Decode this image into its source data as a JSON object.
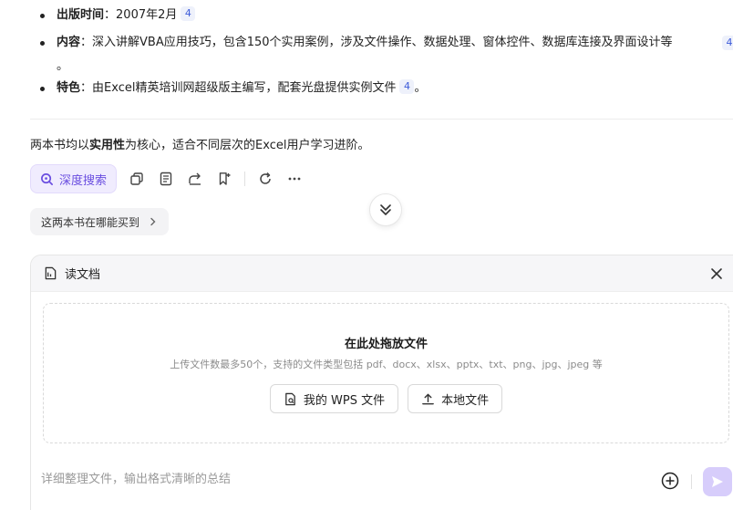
{
  "content": {
    "bullets": [
      {
        "label": "出版时间",
        "sep": "：",
        "text": "2007年2月",
        "cite": "4"
      },
      {
        "label": "内容",
        "sep": "：",
        "text": "深入讲解VBA应用技巧，包含150个实用案例，涉及文件操作、数据处理、窗体控件、数据库连接及界面设计等",
        "cite": "4",
        "tail": "。"
      },
      {
        "label": "特色",
        "sep": "：",
        "text": "由Excel精英培训网超级版主编写，配套光盘提供实例文件",
        "cite": "4",
        "tail": "。"
      }
    ],
    "summary": {
      "pre": "两本书均以",
      "bold": "实用性",
      "post": "为核心，适合不同层次的Excel用户学习进阶。"
    }
  },
  "actions": {
    "deep_search_label": "深度搜索",
    "icons": [
      "copy-icon",
      "document-icon",
      "share-icon",
      "bookmark-icon",
      "refresh-icon",
      "more-icon"
    ]
  },
  "suggestion": {
    "label": "这两本书在哪能买到"
  },
  "panel": {
    "title": "读文档",
    "drop_title": "在此处拖放文件",
    "drop_subtitle": "上传文件数最多50个，支持的文件类型包括 pdf、docx、xlsx、pptx、txt、png、jpg、jpeg 等",
    "wps_button": "我的 WPS 文件",
    "local_button": "本地文件",
    "input_placeholder": "详细整理文件，输出格式清晰的总结"
  },
  "colors": {
    "accent": "#6a4ee0",
    "accent_bg": "#f0ecfe",
    "cite": "#3d5bd9",
    "send_bg": "#d7cdfb"
  }
}
